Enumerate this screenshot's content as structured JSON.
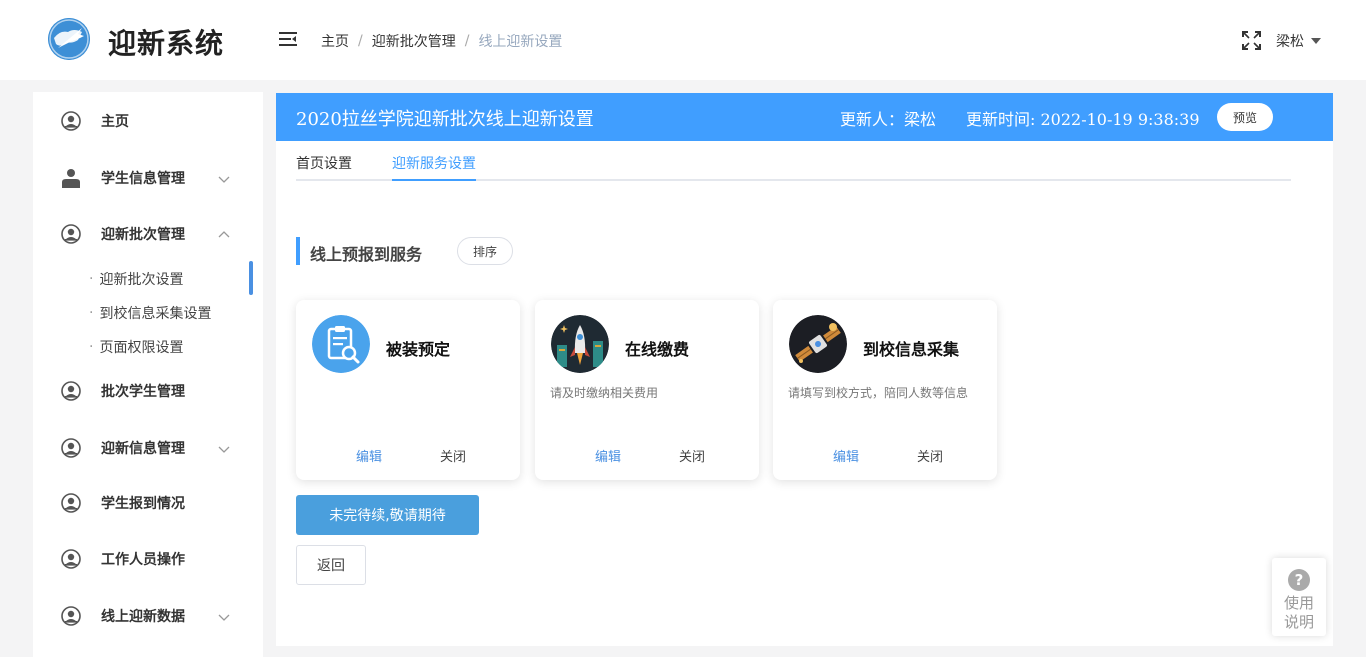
{
  "header": {
    "app_title": "迎新系统",
    "logo_icon": "globe-plane-logo",
    "breadcrumb": [
      "主页",
      "迎新批次管理",
      "线上迎新设置"
    ],
    "user_name": "梁松"
  },
  "sidebar": {
    "items": [
      {
        "label": "主页",
        "icon": "user-circle-icon"
      },
      {
        "label": "学生信息管理",
        "icon": "person-icon",
        "chevron": "down"
      },
      {
        "label": "迎新批次管理",
        "icon": "user-circle-icon",
        "chevron": "up"
      },
      {
        "label": "批次学生管理",
        "icon": "user-circle-icon"
      },
      {
        "label": "迎新信息管理",
        "icon": "user-circle-icon",
        "chevron": "down"
      },
      {
        "label": "学生报到情况",
        "icon": "user-circle-icon"
      },
      {
        "label": "工作人员操作",
        "icon": "user-circle-icon"
      },
      {
        "label": "线上迎新数据",
        "icon": "user-circle-icon",
        "chevron": "down"
      }
    ],
    "sub_items": [
      "迎新批次设置",
      "到校信息采集设置",
      "页面权限设置"
    ],
    "active_sub_item": "迎新批次设置"
  },
  "banner": {
    "title": "2020拉丝学院迎新批次线上迎新设置",
    "updater": "更新人：梁松",
    "update_time": "更新时间: 2022-10-19 9:38:39",
    "preview_label": "预览",
    "color": "#409eff"
  },
  "tabs": [
    {
      "label": "首页设置",
      "active": false
    },
    {
      "label": "迎新服务设置",
      "active": true
    }
  ],
  "section": {
    "title": "线上预报到服务",
    "sort_label": "排序"
  },
  "cards": [
    {
      "title": "被装预定",
      "description": "",
      "icon": "clipboard-search-icon",
      "edit_label": "编辑",
      "close_label": "关闭"
    },
    {
      "title": "在线缴费",
      "description": "请及时缴纳相关费用",
      "icon": "rocket-city-icon",
      "edit_label": "编辑",
      "close_label": "关闭"
    },
    {
      "title": "到校信息采集",
      "description": "请填写到校方式，陪同人数等信息",
      "icon": "satellite-icon",
      "edit_label": "编辑",
      "close_label": "关闭"
    }
  ],
  "buttons": {
    "pending_label": "未完待续,敬请期待",
    "back_label": "返回"
  },
  "help": {
    "icon_glyph": "?",
    "label": "使用说明"
  }
}
